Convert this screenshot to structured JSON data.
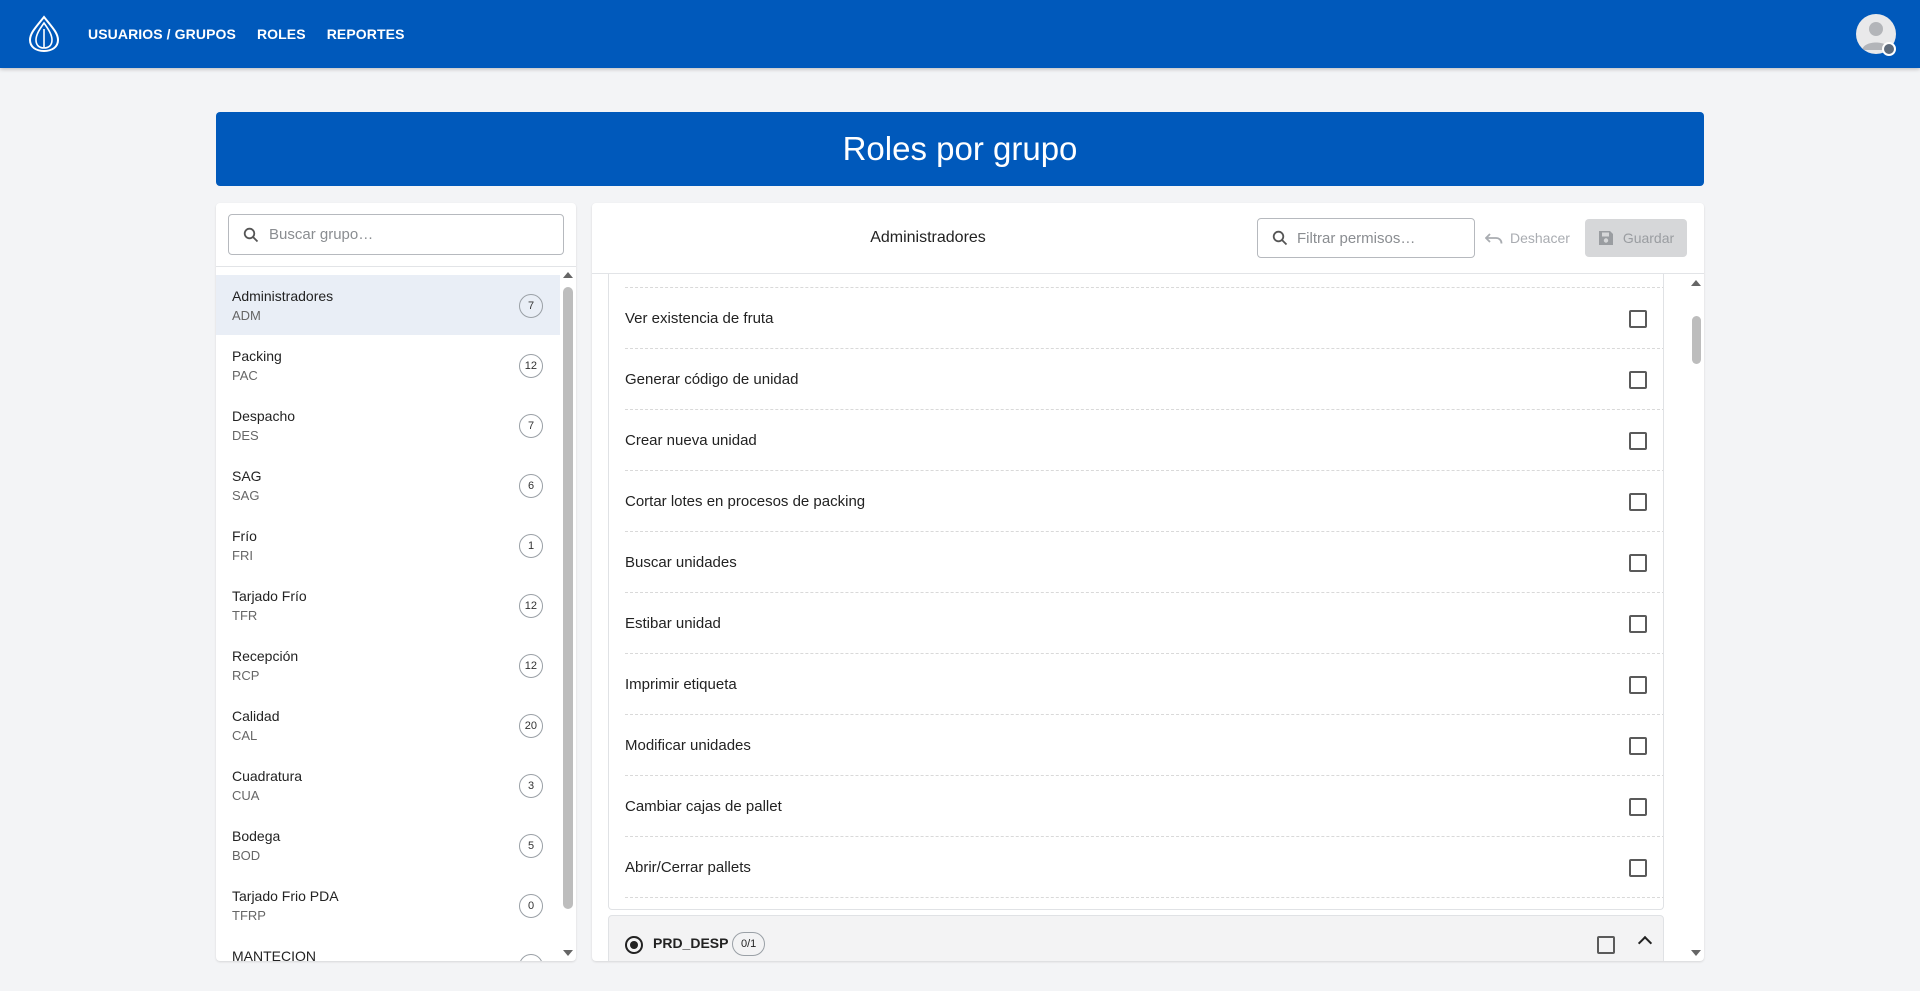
{
  "nav": {
    "items": [
      "USUARIOS / GRUPOS",
      "ROLES",
      "REPORTES"
    ]
  },
  "banner": {
    "title": "Roles por grupo"
  },
  "left": {
    "search_placeholder": "Buscar grupo…",
    "groups": [
      {
        "name": "Administradores",
        "code": "ADM",
        "count": "7",
        "selected": true
      },
      {
        "name": "Packing",
        "code": "PAC",
        "count": "12"
      },
      {
        "name": "Despacho",
        "code": "DES",
        "count": "7"
      },
      {
        "name": "SAG",
        "code": "SAG",
        "count": "6"
      },
      {
        "name": "Frío",
        "code": "FRI",
        "count": "1"
      },
      {
        "name": "Tarjado Frío",
        "code": "TFR",
        "count": "12"
      },
      {
        "name": "Recepción",
        "code": "RCP",
        "count": "12"
      },
      {
        "name": "Calidad",
        "code": "CAL",
        "count": "20"
      },
      {
        "name": "Cuadratura",
        "code": "CUA",
        "count": "3"
      },
      {
        "name": "Bodega",
        "code": "BOD",
        "count": "5"
      },
      {
        "name": "Tarjado Frio PDA",
        "code": "TFRP",
        "count": "0"
      },
      {
        "name": "MANTECION",
        "code": "",
        "count": ""
      }
    ]
  },
  "right": {
    "selected_group": "Administradores",
    "filter_placeholder": "Filtrar permisos…",
    "undo_label": "Deshacer",
    "save_label": "Guardar",
    "permissions": [
      "Ver existencia de fruta",
      "Generar código de unidad",
      "Crear nueva unidad",
      "Cortar lotes en procesos de packing",
      "Buscar unidades",
      "Estibar unidad",
      "Imprimir etiqueta",
      "Modificar unidades",
      "Cambiar cajas de pallet",
      "Abrir/Cerrar pallets"
    ],
    "collapsed_group": {
      "name": "PRD_DESP",
      "badge": "0/1"
    }
  },
  "colors": {
    "primary": "#0059bb",
    "background": "#f3f4f6",
    "selected_row": "#e9eef6"
  },
  "icons": [
    "app-logo-icon",
    "search-icon",
    "undo-icon",
    "save-icon",
    "avatar-icon",
    "edit-icon",
    "chevron-up-icon",
    "radio-checked-icon"
  ]
}
